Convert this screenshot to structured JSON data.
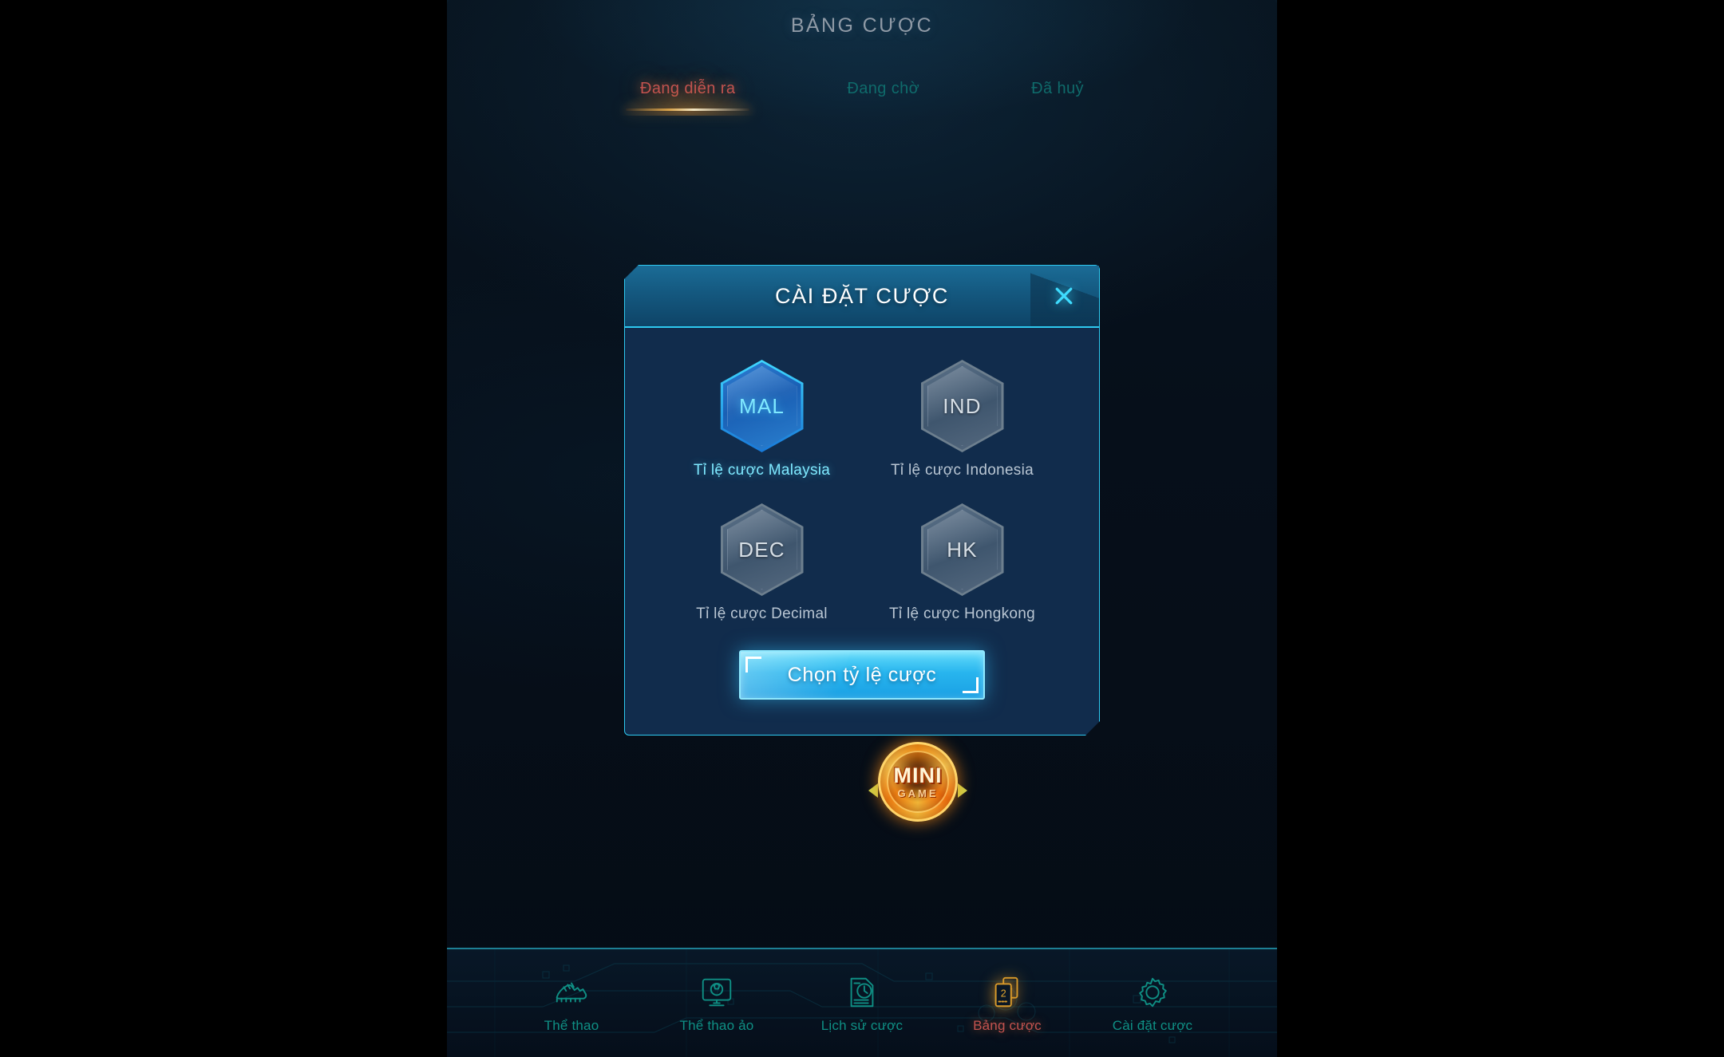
{
  "header": {
    "title": "BẢNG CƯỢC"
  },
  "tabs": [
    {
      "label": "Đang diễn ra",
      "active": true
    },
    {
      "label": "Đang chờ",
      "active": false
    },
    {
      "label": "Đã huỷ",
      "active": false
    }
  ],
  "modal": {
    "title": "CÀI ĐẶT CƯỢC",
    "close_icon": "close-icon",
    "options": [
      {
        "code": "MAL",
        "label": "Tỉ lệ cược Malaysia",
        "selected": true
      },
      {
        "code": "IND",
        "label": "Tỉ lệ cược Indonesia",
        "selected": false
      },
      {
        "code": "DEC",
        "label": "Tỉ lệ cược Decimal",
        "selected": false
      },
      {
        "code": "HK",
        "label": "Tỉ lệ cược Hongkong",
        "selected": false
      }
    ],
    "confirm_label": "Chọn tỷ lệ cược"
  },
  "minigame": {
    "line1": "MINI",
    "line2": "GAME",
    "left_arrow_icon": "arrow-left-icon",
    "right_arrow_icon": "arrow-right-icon"
  },
  "bottom_nav": [
    {
      "label": "Thể thao",
      "icon": "football-boot-icon",
      "active": false
    },
    {
      "label": "Thể thao ảo",
      "icon": "virtual-sports-monitor-icon",
      "active": false
    },
    {
      "label": "Lịch sử cược",
      "icon": "bet-history-clock-icon",
      "active": false
    },
    {
      "label": "Bảng cược",
      "icon": "bet-slip-cards-icon",
      "active": true
    },
    {
      "label": "Cài đặt cược",
      "icon": "gear-icon",
      "active": false
    }
  ],
  "colors": {
    "accent_cyan": "#2ec9f0",
    "active_orange": "#c2534f",
    "nav_teal": "#0f8f84",
    "modal_body": "#112c4c",
    "modal_header": "#14587f"
  }
}
